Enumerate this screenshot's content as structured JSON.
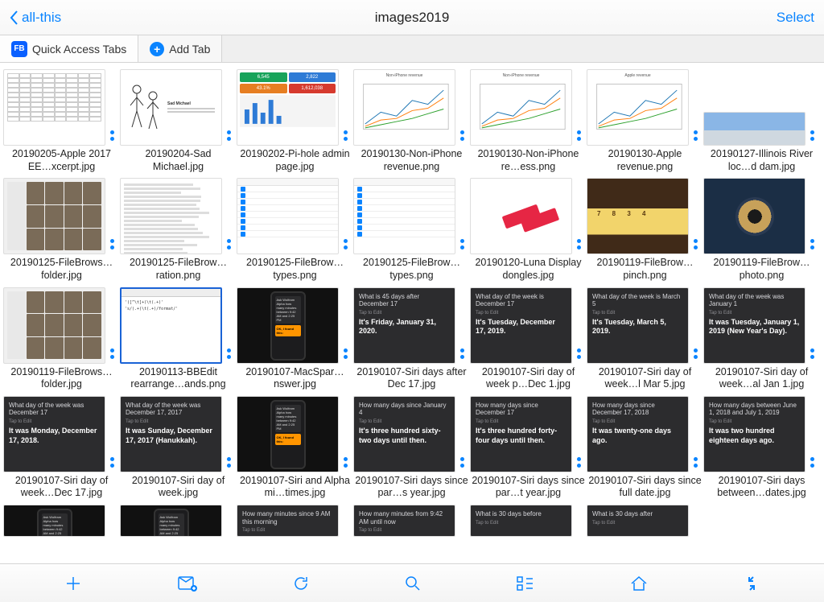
{
  "nav": {
    "back": "all-this",
    "title": "images2019",
    "select": "Select"
  },
  "tabs": {
    "quick": "Quick Access Tabs",
    "add": "Add Tab"
  },
  "files": [
    {
      "name": "20190205-Apple 2017 EE…xcerpt.jpg",
      "kind": "table"
    },
    {
      "name": "20190204-Sad Michael.jpg",
      "kind": "sketch"
    },
    {
      "name": "20190202-Pi-hole admin page.jpg",
      "kind": "dashboard"
    },
    {
      "name": "20190130-Non-iPhone revenue.png",
      "kind": "chart",
      "title": "Non-iPhone revenue"
    },
    {
      "name": "20190130-Non-iPhone re…ess.png",
      "kind": "chart",
      "title": "Non-iPhone revenue"
    },
    {
      "name": "20190130-Apple revenue.png",
      "kind": "chart",
      "title": "Apple revenue"
    },
    {
      "name": "20190127-Illinois River loc…d dam.jpg",
      "kind": "pano"
    },
    {
      "name": "20190125-FileBrows…folder.jpg",
      "kind": "photogrid"
    },
    {
      "name": "20190125-FileBrow…ration.png",
      "kind": "textpage"
    },
    {
      "name": "20190125-FileBrow…types.png",
      "kind": "ioslist"
    },
    {
      "name": "20190125-FileBrow…types.png",
      "kind": "ioslist"
    },
    {
      "name": "20190120-Luna Display dongles.jpg",
      "kind": "usb"
    },
    {
      "name": "20190119-FileBrow…pinch.png",
      "kind": "tape"
    },
    {
      "name": "20190119-FileBrow…photo.png",
      "kind": "pipe"
    },
    {
      "name": "20190119-FileBrows…folder.jpg",
      "kind": "photogrid"
    },
    {
      "name": "20190113-BBEdit rearrange…ands.png",
      "kind": "code"
    },
    {
      "name": "20190107-MacSpar…nswer.jpg",
      "kind": "phone"
    },
    {
      "name": "20190107-Siri days after Dec 17.jpg",
      "kind": "siri",
      "q": "What is 45 days after December 17",
      "a": "It's Friday, January 31, 2020."
    },
    {
      "name": "20190107-Siri day of week p…Dec 1.jpg",
      "kind": "siri",
      "q": "What day of the week is December 17",
      "a": "It's Tuesday, December 17, 2019."
    },
    {
      "name": "20190107-Siri day of week…l Mar 5.jpg",
      "kind": "siri",
      "q": "What day of the week is March 5",
      "a": "It's Tuesday, March 5, 2019."
    },
    {
      "name": "20190107-Siri day of week…al Jan 1.jpg",
      "kind": "siri",
      "q": "What day of the week was January 1",
      "a": "It was Tuesday, January 1, 2019 (New Year's Day)."
    },
    {
      "name": "20190107-Siri day of week…Dec 17.jpg",
      "kind": "siri",
      "q": "What day of the week was December 17",
      "a": "It was Monday, December 17, 2018."
    },
    {
      "name": "20190107-Siri day of week.jpg",
      "kind": "siri",
      "q": "What day of the week was December 17, 2017",
      "a": "It was Sunday, December 17, 2017 (Hanukkah)."
    },
    {
      "name": "20190107-Siri and Alpha mi…times.jpg",
      "kind": "phone2"
    },
    {
      "name": "20190107-Siri days since par…s year.jpg",
      "kind": "siri",
      "q": "How many days since January 4",
      "a": "It's three hundred sixty-two days until then."
    },
    {
      "name": "20190107-Siri days since par…t year.jpg",
      "kind": "siri",
      "q": "How many days since December 17",
      "a": "It's three hundred forty-four days until then."
    },
    {
      "name": "20190107-Siri days since full date.jpg",
      "kind": "siri",
      "q": "How many days since December 17, 2018",
      "a": "It was twenty-one days ago."
    },
    {
      "name": "20190107-Siri days between…dates.jpg",
      "kind": "siri",
      "q": "How many days between June 1, 2018 and July 1, 2019",
      "a": "It was two hundred eighteen days ago."
    },
    {
      "name": "",
      "kind": "phone",
      "partial": true
    },
    {
      "name": "",
      "kind": "phone",
      "partial": true
    },
    {
      "name": "",
      "kind": "siri",
      "q": "How many minutes since 9 AM this morning",
      "a": "",
      "partial": true
    },
    {
      "name": "",
      "kind": "siri",
      "q": "How many minutes from 9:42 AM until now",
      "a": "",
      "partial": true
    },
    {
      "name": "",
      "kind": "siri",
      "q": "What is 30 days before",
      "a": "",
      "partial": true
    },
    {
      "name": "",
      "kind": "siri",
      "q": "What is 30 days after",
      "a": "",
      "partial": true
    }
  ],
  "siri_hint": "Tap to Edit",
  "dash": {
    "a": "6,545",
    "b": "2,822",
    "c": "43.1%",
    "d": "1,612,038"
  }
}
